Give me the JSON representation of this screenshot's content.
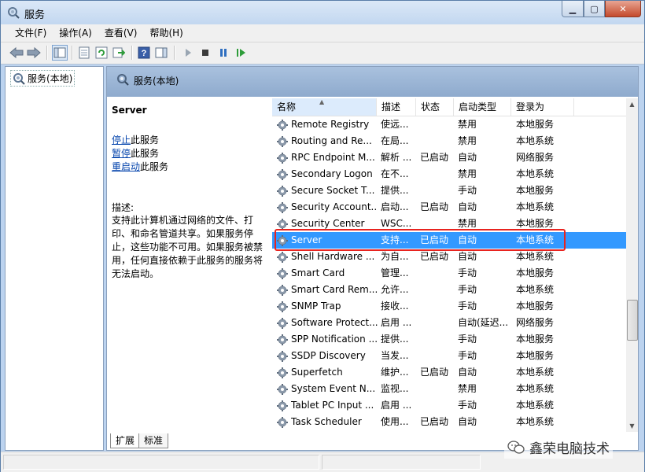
{
  "window": {
    "title": "服务"
  },
  "menu": {
    "items": [
      "文件(F)",
      "操作(A)",
      "查看(V)",
      "帮助(H)"
    ]
  },
  "tree": {
    "root": "服务(本地)"
  },
  "content": {
    "header": "服务(本地)",
    "selected_service": "Server",
    "actions": [
      {
        "link": "停止",
        "suffix": "此服务"
      },
      {
        "link": "暂停",
        "suffix": "此服务"
      },
      {
        "link": "重启动",
        "suffix": "此服务"
      }
    ],
    "description_label": "描述:",
    "description": "支持此计算机通过网络的文件、打印、和命名管道共享。如果服务停止，这些功能不可用。如果服务被禁用，任何直接依赖于此服务的服务将无法启动。"
  },
  "list": {
    "columns": [
      "名称",
      "描述",
      "状态",
      "启动类型",
      "登录为"
    ],
    "rows": [
      {
        "name": "Remote Registry",
        "desc": "使远...",
        "status": "",
        "startup": "禁用",
        "logon": "本地服务"
      },
      {
        "name": "Routing and Re...",
        "desc": "在局...",
        "status": "",
        "startup": "禁用",
        "logon": "本地系统"
      },
      {
        "name": "RPC Endpoint M...",
        "desc": "解析 ...",
        "status": "已启动",
        "startup": "自动",
        "logon": "网络服务"
      },
      {
        "name": "Secondary Logon",
        "desc": "在不...",
        "status": "",
        "startup": "禁用",
        "logon": "本地系统"
      },
      {
        "name": "Secure Socket T...",
        "desc": "提供...",
        "status": "",
        "startup": "手动",
        "logon": "本地服务"
      },
      {
        "name": "Security Account...",
        "desc": "启动...",
        "status": "已启动",
        "startup": "自动",
        "logon": "本地系统"
      },
      {
        "name": "Security Center",
        "desc": "WSC...",
        "status": "",
        "startup": "禁用",
        "logon": "本地服务"
      },
      {
        "name": "Server",
        "desc": "支持...",
        "status": "已启动",
        "startup": "自动",
        "logon": "本地系统",
        "selected": true
      },
      {
        "name": "Shell Hardware ...",
        "desc": "为自...",
        "status": "已启动",
        "startup": "自动",
        "logon": "本地系统"
      },
      {
        "name": "Smart Card",
        "desc": "管理...",
        "status": "",
        "startup": "手动",
        "logon": "本地服务"
      },
      {
        "name": "Smart Card Rem...",
        "desc": "允许...",
        "status": "",
        "startup": "手动",
        "logon": "本地系统"
      },
      {
        "name": "SNMP Trap",
        "desc": "接收...",
        "status": "",
        "startup": "手动",
        "logon": "本地服务"
      },
      {
        "name": "Software Protect...",
        "desc": "启用 ...",
        "status": "",
        "startup": "自动(延迟...",
        "logon": "网络服务"
      },
      {
        "name": "SPP Notification ...",
        "desc": "提供...",
        "status": "",
        "startup": "手动",
        "logon": "本地服务"
      },
      {
        "name": "SSDP Discovery",
        "desc": "当发...",
        "status": "",
        "startup": "手动",
        "logon": "本地服务"
      },
      {
        "name": "Superfetch",
        "desc": "维护...",
        "status": "已启动",
        "startup": "自动",
        "logon": "本地系统"
      },
      {
        "name": "System Event N...",
        "desc": "监视...",
        "status": "",
        "startup": "禁用",
        "logon": "本地系统"
      },
      {
        "name": "Tablet PC Input ...",
        "desc": "启用 ...",
        "status": "",
        "startup": "手动",
        "logon": "本地系统"
      },
      {
        "name": "Task Scheduler",
        "desc": "使用...",
        "status": "已启动",
        "startup": "自动",
        "logon": "本地系统"
      }
    ]
  },
  "tabs": [
    "扩展",
    "标准"
  ],
  "watermark": "鑫荣电脑技术",
  "icons": {
    "title": "gear-magnifier-icon",
    "back": "back-arrow-icon",
    "forward": "forward-arrow-icon",
    "play": "play-icon",
    "stop": "stop-icon",
    "pause": "pause-icon",
    "restart": "restart-icon",
    "help": "help-icon"
  },
  "colors": {
    "selection": "#3399ff",
    "highlight_box": "#e8231f",
    "link": "#0645ad"
  }
}
